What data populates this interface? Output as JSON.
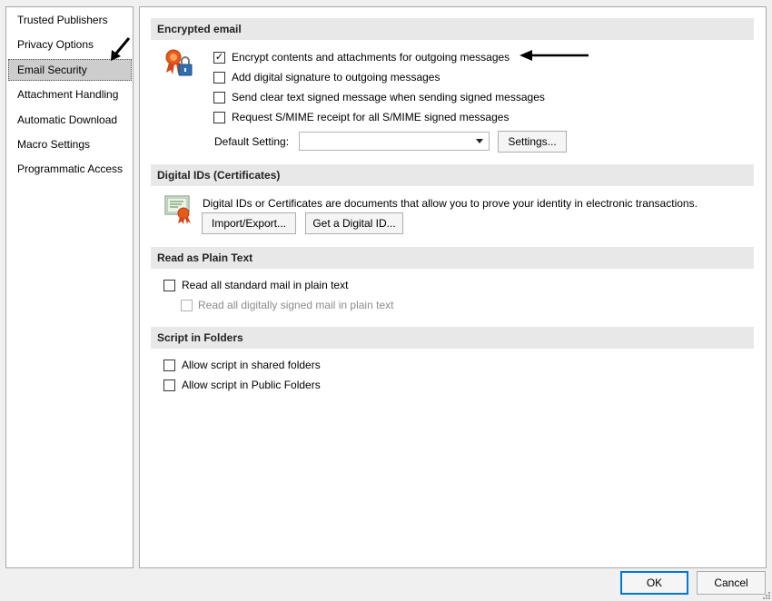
{
  "sidebar": {
    "items": [
      {
        "label": "Trusted Publishers"
      },
      {
        "label": "Privacy Options"
      },
      {
        "label": "Email Security",
        "selected": true
      },
      {
        "label": "Attachment Handling"
      },
      {
        "label": "Automatic Download"
      },
      {
        "label": "Macro Settings"
      },
      {
        "label": "Programmatic Access"
      }
    ]
  },
  "encrypted_email": {
    "header": "Encrypted email",
    "icon": "encryption-ribbon-lock-icon",
    "options": [
      {
        "label": "Encrypt contents and attachments for outgoing messages",
        "checked": true
      },
      {
        "label": "Add digital signature to outgoing messages",
        "checked": false
      },
      {
        "label": "Send clear text signed message when sending signed messages",
        "checked": false
      },
      {
        "label": "Request S/MIME receipt for all S/MIME signed messages",
        "checked": false
      }
    ],
    "default_setting_label": "Default Setting:",
    "default_setting_value": "",
    "settings_button": "Settings..."
  },
  "digital_ids": {
    "header": "Digital IDs (Certificates)",
    "icon": "certificate-icon",
    "description": "Digital IDs or Certificates are documents that allow you to prove your identity in electronic transactions.",
    "import_export_button": "Import/Export...",
    "get_id_button": "Get a Digital ID..."
  },
  "plain_text": {
    "header": "Read as Plain Text",
    "options": [
      {
        "label": "Read all standard mail in plain text",
        "checked": false,
        "disabled": false
      },
      {
        "label": "Read all digitally signed mail in plain text",
        "checked": false,
        "disabled": true
      }
    ]
  },
  "script_folders": {
    "header": "Script in Folders",
    "options": [
      {
        "label": "Allow script in shared folders",
        "checked": false
      },
      {
        "label": "Allow script in Public Folders",
        "checked": false
      }
    ]
  },
  "footer": {
    "ok_button": "OK",
    "cancel_button": "Cancel"
  },
  "colors": {
    "accent": "#0078d7",
    "selected_bg": "#cdcdcd",
    "section_bg": "#e8e8e8"
  }
}
